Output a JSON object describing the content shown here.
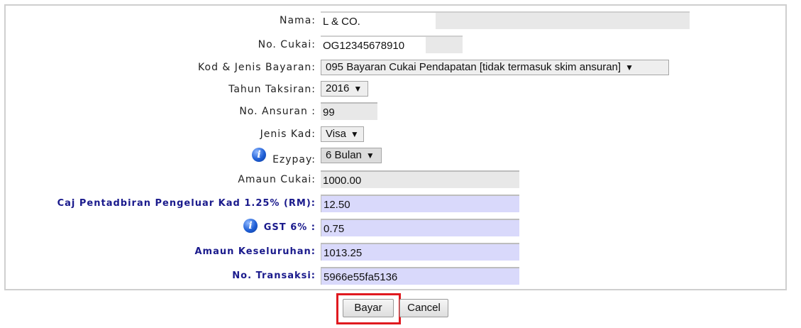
{
  "form": {
    "nama": {
      "label": "Nama:",
      "value": "L & CO."
    },
    "no_cukai": {
      "label": "No. Cukai:",
      "value": "OG12345678910"
    },
    "kod_jenis": {
      "label": "Kod & Jenis Bayaran:",
      "selected": "095 Bayaran Cukai Pendapatan [tidak termasuk skim ansuran]"
    },
    "tahun": {
      "label": "Tahun Taksiran:",
      "selected": "2016"
    },
    "ansuran": {
      "label": "No. Ansuran :",
      "value": "99"
    },
    "jenis_kad": {
      "label": "Jenis Kad:",
      "selected": "Visa"
    },
    "ezypay": {
      "label": "Ezypay:",
      "selected": "6 Bulan"
    },
    "amaun_cukai": {
      "label": "Amaun Cukai:",
      "value": "1000.00"
    },
    "caj": {
      "label": "Caj Pentadbiran Pengeluar Kad 1.25% (RM):",
      "value": "12.50"
    },
    "gst": {
      "label": "GST 6% :",
      "value": "0.75"
    },
    "amaun_keseluruhan": {
      "label": "Amaun Keseluruhan:",
      "value": "1013.25"
    },
    "transaksi": {
      "label": "No. Transaksi:",
      "value": "5966e55fa5136"
    }
  },
  "buttons": {
    "bayar": "Bayar",
    "cancel": "Cancel"
  },
  "icons": {
    "info": "info-icon",
    "dropdown": "triangle-down"
  },
  "colors": {
    "bold_label": "#1a1a8c",
    "readonly_blue": "#d9d9fb",
    "readonly_grey": "#e8e8e8",
    "highlight": "#e0191f"
  }
}
